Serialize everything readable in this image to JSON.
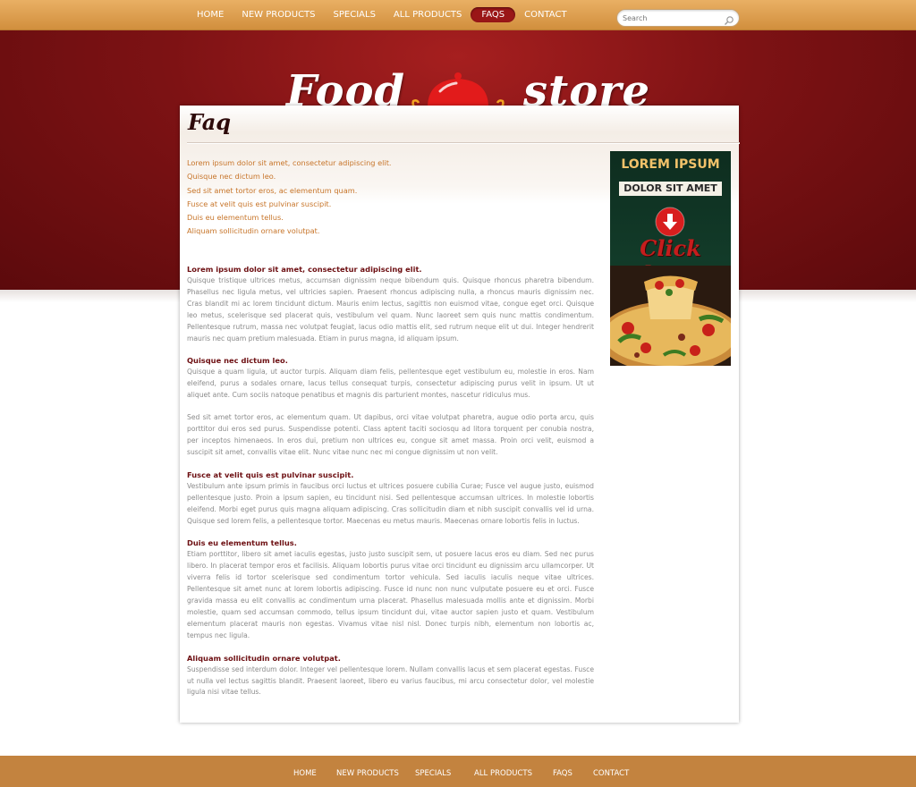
{
  "nav": {
    "items": [
      {
        "label": "HOME",
        "active": false
      },
      {
        "label": "NEW PRODUCTS",
        "active": false
      },
      {
        "label": "SPECIALS",
        "active": false
      },
      {
        "label": "ALL PRODUCTS",
        "active": false
      },
      {
        "label": "FAQS",
        "active": true
      },
      {
        "label": "CONTACT",
        "active": false
      }
    ]
  },
  "search": {
    "placeholder": "Search",
    "icon": "search-icon"
  },
  "logo": {
    "word1": "Food",
    "word2": "store",
    "icon": "cloche-icon"
  },
  "page": {
    "title": "Faq"
  },
  "faq_links": [
    "Lorem ipsum dolor sit amet, consectetur adipiscing elit.",
    "Quisque nec dictum leo.",
    "Sed sit amet tortor eros, ac elementum quam.",
    "Fusce at velit quis est pulvinar suscipit.",
    "Duis eu elementum tellus.",
    "Aliquam sollicitudin ornare volutpat."
  ],
  "faqs": [
    {
      "question": "Lorem ipsum dolor sit amet, consectetur adipiscing elit.",
      "answers": [
        "Quisque tristique ultrices metus, accumsan dignissim neque bibendum quis. Quisque rhoncus pharetra bibendum. Phasellus nec ligula metus, vel ultricies sapien. Praesent rhoncus adipiscing nulla, a rhoncus mauris dignissim nec. Cras blandit mi ac lorem tincidunt dictum. Mauris enim lectus, sagittis non euismod vitae, congue eget orci. Quisque leo metus, scelerisque sed placerat quis, vestibulum vel quam. Nunc laoreet sem quis nunc mattis condimentum. Pellentesque rutrum, massa nec volutpat feugiat, lacus odio mattis elit, sed rutrum neque elit ut dui. Integer hendrerit mauris nec quam pretium malesuada. Etiam in purus magna, id aliquam ipsum."
      ]
    },
    {
      "question": "Quisque nec dictum leo.",
      "answers": [
        "Quisque a quam ligula, ut auctor turpis. Aliquam diam felis, pellentesque eget vestibulum eu, molestie in eros. Nam eleifend, purus a sodales ornare, lacus tellus consequat turpis, consectetur adipiscing purus velit in ipsum. Ut ut aliquet ante. Cum sociis natoque penatibus et magnis dis parturient montes, nascetur ridiculus mus.",
        "Sed sit amet tortor eros, ac elementum quam. Ut dapibus, orci vitae volutpat pharetra, augue odio porta arcu, quis porttitor dui eros sed purus. Suspendisse potenti. Class aptent taciti sociosqu ad litora torquent per conubia nostra, per inceptos himenaeos. In eros dui, pretium non ultrices eu, congue sit amet massa. Proin orci velit, euismod a suscipit sit amet, convallis vitae elit. Nunc vitae nunc nec mi congue dignissim ut non velit."
      ]
    },
    {
      "question": "Fusce at velit quis est pulvinar suscipit.",
      "answers": [
        "Vestibulum ante ipsum primis in faucibus orci luctus et ultrices posuere cubilia Curae; Fusce vel augue justo, euismod pellentesque justo. Proin a ipsum sapien, eu tincidunt nisi. Sed pellentesque accumsan ultrices. In molestie lobortis eleifend. Morbi eget purus quis magna aliquam adipiscing. Cras sollicitudin diam et nibh suscipit convallis vel id urna. Quisque sed lorem felis, a pellentesque tortor. Maecenas eu metus mauris. Maecenas ornare lobortis felis in luctus."
      ]
    },
    {
      "question": "Duis eu elementum tellus.",
      "answers": [
        "Etiam porttitor, libero sit amet iaculis egestas, justo justo suscipit sem, ut posuere lacus eros eu diam. Sed nec purus libero. In placerat tempor eros et facilisis. Aliquam lobortis purus vitae orci tincidunt eu dignissim arcu ullamcorper. Ut viverra felis id tortor scelerisque sed condimentum tortor vehicula. Sed iaculis iaculis neque vitae ultrices. Pellentesque sit amet nunc at lorem lobortis adipiscing. Fusce id nunc non nunc vulputate posuere eu et orci. Fusce gravida massa eu elit convallis ac condimentum urna placerat. Phasellus malesuada mollis ante et dignissim. Morbi molestie, quam sed accumsan commodo, tellus ipsum tincidunt dui, vitae auctor sapien justo et quam. Vestibulum elementum placerat mauris non egestas. Vivamus vitae nisl nisl. Donec turpis nibh, elementum non lobortis ac, tempus nec ligula."
      ]
    },
    {
      "question": "Aliquam sollicitudin ornare volutpat.",
      "answers": [
        "Suspendisse sed interdum dolor. Integer vel pellentesque lorem. Nullam convallis lacus et sem placerat egestas. Fusce ut nulla vel lectus sagittis blandit. Praesent laoreet, libero eu varius faucibus, mi arcu consectetur dolor, vel molestie ligula nisi vitae tellus."
      ]
    }
  ],
  "ad": {
    "headline": "LOREM IPSUM",
    "subline": "DOLOR SIT AMET",
    "cta": "Click here",
    "icon": "arrow-down-icon"
  },
  "footer": {
    "items": [
      "HOME",
      "NEW PRODUCTS",
      "SPECIALS",
      "ALL PRODUCTS",
      "FAQS",
      "CONTACT"
    ]
  },
  "colors": {
    "topbar": "#d9a053",
    "banner": "#7d1214",
    "active_nav": "#9a1617",
    "link": "#c7752a",
    "question": "#6d0f12",
    "footer": "#c3833f"
  }
}
